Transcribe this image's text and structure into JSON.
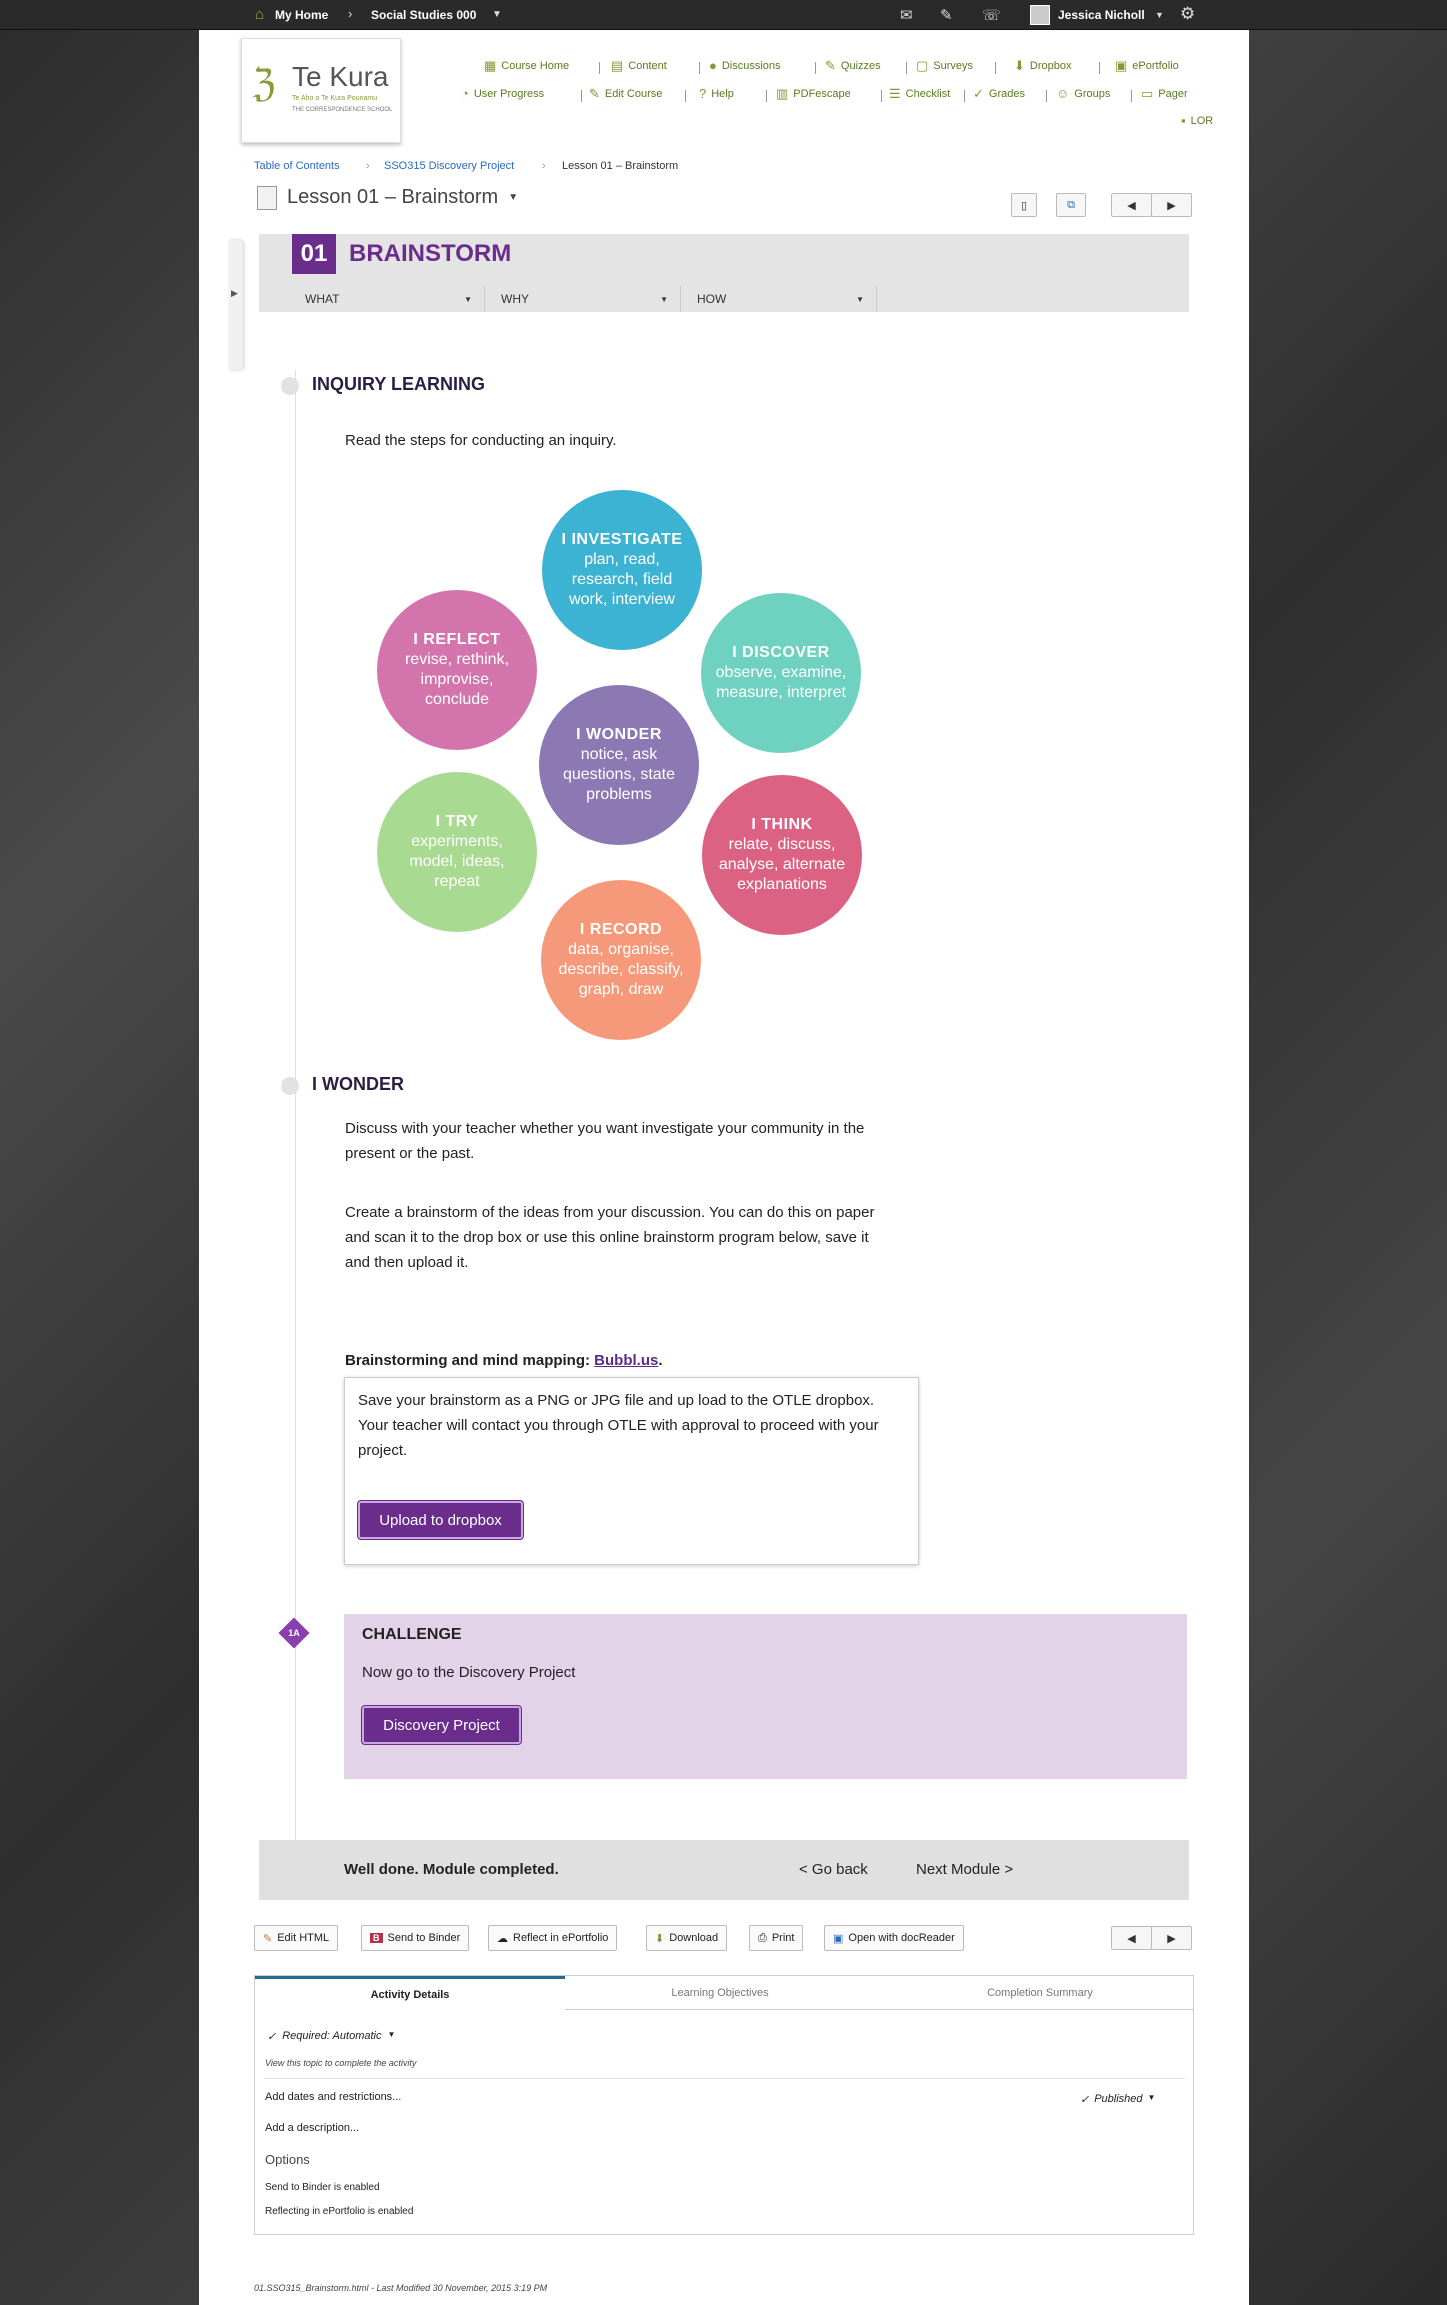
{
  "topbar": {
    "home": "My Home",
    "course": "Social Studies 000",
    "user": "Jessica Nicholl"
  },
  "logo": {
    "name": "Te Kura",
    "sub1": "Te Aho o Te Kura Pounamu",
    "sub2": "THE CORRESPONDENCE SCHOOL"
  },
  "nav": {
    "row1": [
      "Course Home",
      "Content",
      "Discussions",
      "Quizzes",
      "Surveys",
      "Dropbox",
      "ePortfolio"
    ],
    "row2": [
      "User Progress",
      "Edit Course",
      "Help",
      "PDFescape",
      "Checklist",
      "Grades",
      "Groups",
      "Pager"
    ],
    "row3": [
      "LOR"
    ]
  },
  "breadcrumb": {
    "toc": "Table of Contents",
    "project": "SSO315 Discovery Project",
    "current": "Lesson 01 – Brainstorm"
  },
  "lesson_title": "Lesson 01 – Brainstorm",
  "module": {
    "number": "01",
    "title": "BRAINSTORM",
    "tabs": [
      "WHAT",
      "WHY",
      "HOW"
    ]
  },
  "inquiry": {
    "heading": "INQUIRY LEARNING",
    "intro": "Read the steps for conducting an inquiry.",
    "steps": [
      {
        "title": "I INVESTIGATE",
        "text": "plan, read, research, field work, interview",
        "color": "#3db3d3"
      },
      {
        "title": "I DISCOVER",
        "text": "observe, examine, measure, interpret",
        "color": "#6fd1c0"
      },
      {
        "title": "I THINK",
        "text": "relate, discuss, analyse, alternate explanations",
        "color": "#dc6283"
      },
      {
        "title": "I RECORD",
        "text": "data, organise, describe, classify, graph, draw",
        "color": "#f5997a"
      },
      {
        "title": "I TRY",
        "text": "experiments, model, ideas, repeat",
        "color": "#a9da92"
      },
      {
        "title": "I REFLECT",
        "text": "revise, rethink, improvise, conclude",
        "color": "#d374ad"
      },
      {
        "title": "I WONDER",
        "text": "notice, ask questions, state problems",
        "color": "#8c78b3"
      }
    ]
  },
  "wonder": {
    "heading": "I WONDER",
    "p1": "Discuss with your teacher whether you want investigate your community in the present or the past.",
    "p2": "Create a brainstorm of the ideas from your discussion. You can do this on paper and scan it to the drop box or use this online brainstorm program below, save it and then upload it.",
    "mapping_label": "Brainstorming and mind mapping: ",
    "mapping_link": "Bubbl.us",
    "box_text": "Save your brainstorm as a PNG or JPG file and up load to the OTLE dropbox. Your teacher will contact you through OTLE with approval to proceed with your project.",
    "upload_button": "Upload to dropbox"
  },
  "challenge": {
    "badge": "1A",
    "heading": "CHALLENGE",
    "text": "Now go to the Discovery Project",
    "button": "Discovery Project"
  },
  "footer": {
    "done": "Well done. Module completed.",
    "back": "< Go back",
    "next": "Next Module >"
  },
  "toolbar": [
    "Edit HTML",
    "Send to Binder",
    "Reflect in ePortfolio",
    "Download",
    "Print",
    "Open with docReader"
  ],
  "details": {
    "tabs": [
      "Activity Details",
      "Learning Objectives",
      "Completion Summary"
    ],
    "required": "Required: Automatic",
    "view_hint": "View this topic to complete the activity",
    "dates": "Add dates and restrictions...",
    "description": "Add a description...",
    "published": "Published",
    "options_heading": "Options",
    "binder": "Send to Binder is enabled",
    "reflecting": "Reflecting in ePortfolio is enabled"
  },
  "file_info": "01.SSO315_Brainstorm.html - Last Modified 30 November, 2015 3:19 PM"
}
